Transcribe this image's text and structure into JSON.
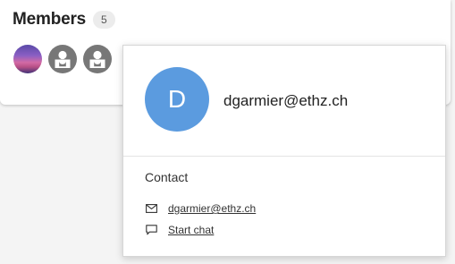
{
  "members": {
    "title": "Members",
    "count": "5",
    "avatars": [
      {
        "kind": "photo"
      },
      {
        "kind": "generic",
        "icon": "user-placeholder-icon"
      },
      {
        "kind": "generic",
        "icon": "user-placeholder-icon"
      }
    ]
  },
  "profile": {
    "initial": "D",
    "name": "dgarmier@ethz.ch",
    "avatar_color": "#5b9bdf",
    "contact_heading": "Contact",
    "email_icon": "mail-icon",
    "email": "dgarmier@ethz.ch",
    "chat_icon": "chat-bubble-icon",
    "chat_label": "Start chat"
  }
}
